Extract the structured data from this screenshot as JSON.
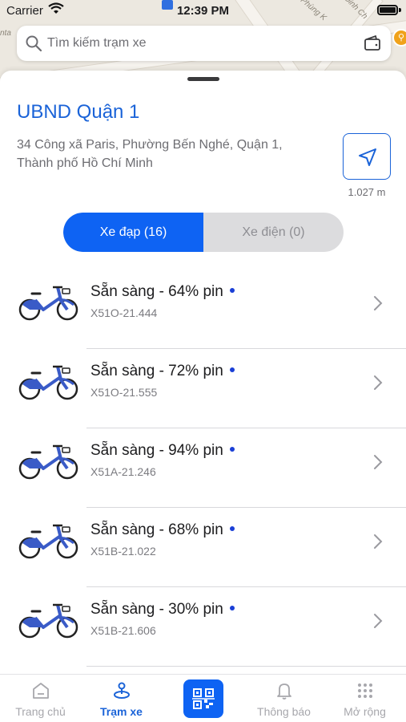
{
  "status_bar": {
    "carrier": "Carrier",
    "time": "12:39 PM"
  },
  "map": {
    "labels": [
      "nta",
      "Phùng K",
      "Đinh Ch"
    ]
  },
  "search": {
    "placeholder": "Tìm kiếm trạm xe"
  },
  "station": {
    "name": "UBND Quận 1",
    "address": "34 Công xã Paris, Phường Bến Nghé, Quận 1, Thành phố Hồ Chí Minh",
    "distance": "1.027 m"
  },
  "tabs": {
    "bikes": "Xe đạp (16)",
    "ebikes": "Xe điện (0)"
  },
  "vehicles": [
    {
      "status": "Sẵn sàng - 64% pin",
      "plate": "X51O-21.444"
    },
    {
      "status": "Sẵn sàng - 72% pin",
      "plate": "X51O-21.555"
    },
    {
      "status": "Sẵn sàng - 94% pin",
      "plate": "X51A-21.246"
    },
    {
      "status": "Sẵn sàng - 68% pin",
      "plate": "X51B-21.022"
    },
    {
      "status": "Sẵn sàng - 30% pin",
      "plate": "X51B-21.606"
    }
  ],
  "bottom_nav": {
    "home": "Trang chủ",
    "stations": "Trạm xe",
    "notifications": "Thông báo",
    "more": "Mở rộng"
  },
  "colors": {
    "accent": "#0e63f3",
    "title_blue": "#1a63d8",
    "bike_blue": "#3a5bc7",
    "dot_blue": "#1a3fd6"
  }
}
